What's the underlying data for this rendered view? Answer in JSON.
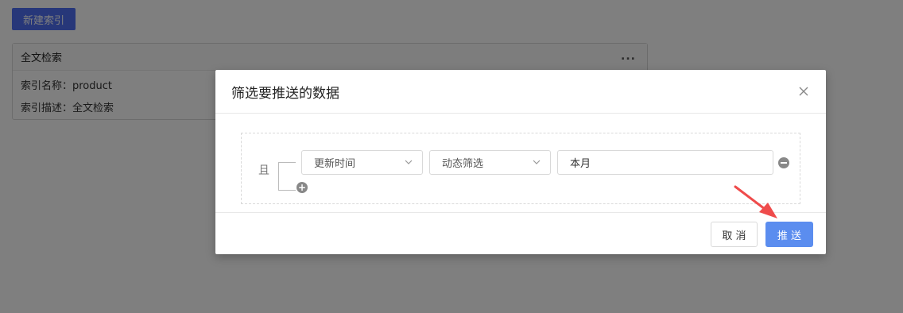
{
  "page": {
    "new_index_button": "新建索引",
    "card": {
      "title": "全文检索",
      "more_icon": "...",
      "name_row": "索引名称：product",
      "desc_row": "索引描述：全文检索"
    }
  },
  "modal": {
    "title": "筛选要推送的数据",
    "close_icon": "close-icon",
    "filter": {
      "logic_label": "且",
      "field_select": "更新时间",
      "mode_select": "动态筛选",
      "value": "本月",
      "add_icon": "+"
    },
    "footer": {
      "cancel_label": "取 消",
      "push_label": "推 送"
    }
  },
  "colors": {
    "primary": "#5b8def",
    "overlay": "rgba(0,0,0,0.5)",
    "annotation_arrow": "#ef4b4b"
  }
}
